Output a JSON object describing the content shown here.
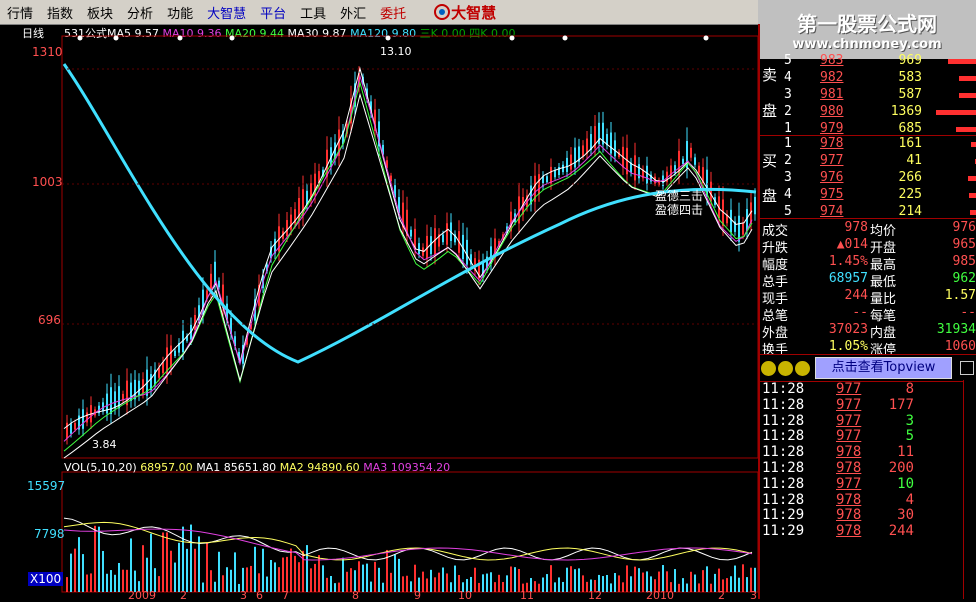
{
  "menu": [
    "行情",
    "指数",
    "板块",
    "分析",
    "功能",
    "大智慧",
    "平台",
    "工具",
    "外汇",
    "委托"
  ],
  "menu_logo": "大智慧",
  "brand": {
    "line1": "第一股票公式网",
    "line2": "www.chnmoney.com"
  },
  "chart": {
    "period_label": "日线",
    "formula_label": "531公式",
    "ma_legend": [
      {
        "name": "MA5",
        "value": "9.57",
        "color": "#ffffff"
      },
      {
        "name": "MA10",
        "value": "9.36",
        "color": "#e040e0"
      },
      {
        "name": "MA20",
        "value": "9.44",
        "color": "#40ff40"
      },
      {
        "name": "MA30",
        "value": "9.87",
        "color": "#ffffff"
      },
      {
        "name": "MA120",
        "value": "9.80",
        "color": "#40e0ff"
      },
      {
        "name": "三K",
        "value": "0.00",
        "color": "#00a000"
      },
      {
        "name": "四K",
        "value": "0.00",
        "color": "#00a000"
      }
    ],
    "y_labels": [
      "1310",
      "1003",
      "696"
    ],
    "high_label": "13.10",
    "low_label": "3.84",
    "annotations": [
      "盈德三击",
      "盈德四击"
    ],
    "x_labels": [
      "2009",
      "2",
      "3",
      "6",
      "7",
      "8",
      "9",
      "10",
      "11",
      "12",
      "2010",
      "2",
      "3"
    ],
    "volume": {
      "legend": "VOL(5,10,20)",
      "value": "68957.00",
      "ma1": "MA1 85651.80",
      "ma2": "MA2 94890.60",
      "ma3": "MA3 109354.20",
      "y_labels": [
        "15597",
        "7798"
      ],
      "unit": "X100"
    }
  },
  "order_book": {
    "sell_label": [
      "卖",
      "盘"
    ],
    "buy_label": [
      "买",
      "盘"
    ],
    "sell": [
      {
        "lvl": "5",
        "price": "983",
        "vol": "969"
      },
      {
        "lvl": "4",
        "price": "982",
        "vol": "583"
      },
      {
        "lvl": "3",
        "price": "981",
        "vol": "587"
      },
      {
        "lvl": "2",
        "price": "980",
        "vol": "1369"
      },
      {
        "lvl": "1",
        "price": "979",
        "vol": "685"
      }
    ],
    "buy": [
      {
        "lvl": "1",
        "price": "978",
        "vol": "161"
      },
      {
        "lvl": "2",
        "price": "977",
        "vol": "41"
      },
      {
        "lvl": "3",
        "price": "976",
        "vol": "266"
      },
      {
        "lvl": "4",
        "price": "975",
        "vol": "225"
      },
      {
        "lvl": "5",
        "price": "974",
        "vol": "214"
      }
    ]
  },
  "quote": [
    {
      "l": "成交",
      "v": "978",
      "l2": "均价",
      "v2": "976"
    },
    {
      "l": "升跌",
      "v": "▲014",
      "l2": "开盘",
      "v2": "965"
    },
    {
      "l": "幅度",
      "v": "1.45%",
      "l2": "最高",
      "v2": "985"
    },
    {
      "l": "总手",
      "v": "68957",
      "l2": "最低",
      "v2": "962"
    },
    {
      "l": "现手",
      "v": "244",
      "l2": "量比",
      "v2": "1.57"
    },
    {
      "l": "总笔",
      "v": "--",
      "l2": "每笔",
      "v2": "--"
    },
    {
      "l": "外盘",
      "v": "37023",
      "l2": "内盘",
      "v2": "31934"
    },
    {
      "l": "换手",
      "v": "1.05%",
      "l2": "涨停",
      "v2": "1060"
    }
  ],
  "topview": "点击查看Topview",
  "ticks": [
    {
      "t": "11:28",
      "p": "977",
      "v": "8",
      "c": "#ff5050"
    },
    {
      "t": "11:28",
      "p": "977",
      "v": "177",
      "c": "#ff5050"
    },
    {
      "t": "11:28",
      "p": "977",
      "v": "3",
      "c": "#40ff40"
    },
    {
      "t": "11:28",
      "p": "977",
      "v": "5",
      "c": "#40ff40"
    },
    {
      "t": "11:28",
      "p": "978",
      "v": "11",
      "c": "#ff5050"
    },
    {
      "t": "11:28",
      "p": "978",
      "v": "200",
      "c": "#ff5050"
    },
    {
      "t": "11:28",
      "p": "977",
      "v": "10",
      "c": "#40ff40"
    },
    {
      "t": "11:28",
      "p": "978",
      "v": "4",
      "c": "#ff5050"
    },
    {
      "t": "11:29",
      "p": "978",
      "v": "30",
      "c": "#ff5050"
    },
    {
      "t": "11:29",
      "p": "978",
      "v": "244",
      "c": "#ff5050"
    }
  ]
}
